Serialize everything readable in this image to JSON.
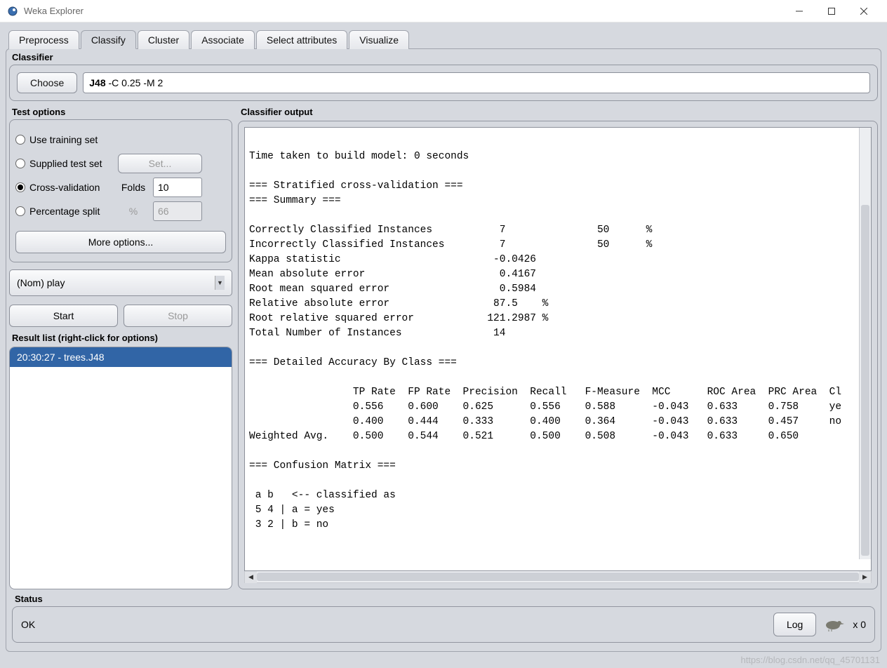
{
  "window": {
    "title": "Weka Explorer"
  },
  "tabs": {
    "items": [
      {
        "label": "Preprocess"
      },
      {
        "label": "Classify"
      },
      {
        "label": "Cluster"
      },
      {
        "label": "Associate"
      },
      {
        "label": "Select attributes"
      },
      {
        "label": "Visualize"
      }
    ],
    "active_index": 1
  },
  "classifier": {
    "heading": "Classifier",
    "choose_label": "Choose",
    "scheme_bold": "J48",
    "scheme_rest": " -C 0.25 -M 2"
  },
  "test_options": {
    "heading": "Test options",
    "use_training_label": "Use training set",
    "supplied_label": "Supplied test set",
    "set_button": "Set...",
    "cv_label": "Cross-validation",
    "folds_label": "Folds",
    "folds_value": "10",
    "pct_label": "Percentage split",
    "pct_symbol": "%",
    "pct_value": "66",
    "more_options": "More options...",
    "selected": "cv"
  },
  "target_attr": {
    "value": "(Nom) play"
  },
  "run": {
    "start": "Start",
    "stop": "Stop"
  },
  "result_list": {
    "heading": "Result list (right-click for options)",
    "items": [
      {
        "label": "20:30:27 - trees.J48"
      }
    ]
  },
  "output": {
    "heading": "Classifier output",
    "text": "\nTime taken to build model: 0 seconds\n\n=== Stratified cross-validation ===\n=== Summary ===\n\nCorrectly Classified Instances           7               50      %\nIncorrectly Classified Instances         7               50      %\nKappa statistic                         -0.0426\nMean absolute error                      0.4167\nRoot mean squared error                  0.5984\nRelative absolute error                 87.5    %\nRoot relative squared error            121.2987 %\nTotal Number of Instances               14     \n\n=== Detailed Accuracy By Class ===\n\n                 TP Rate  FP Rate  Precision  Recall   F-Measure  MCC      ROC Area  PRC Area  Cl\n                 0.556    0.600    0.625      0.556    0.588      -0.043   0.633     0.758     ye\n                 0.400    0.444    0.333      0.400    0.364      -0.043   0.633     0.457     no\nWeighted Avg.    0.500    0.544    0.521      0.500    0.508      -0.043   0.633     0.650     \n\n=== Confusion Matrix ===\n\n a b   <-- classified as\n 5 4 | a = yes\n 3 2 | b = no\n"
  },
  "status": {
    "heading": "Status",
    "text": "OK",
    "log_label": "Log",
    "x_label": "x 0"
  },
  "watermark": "https://blog.csdn.net/qq_45701131"
}
